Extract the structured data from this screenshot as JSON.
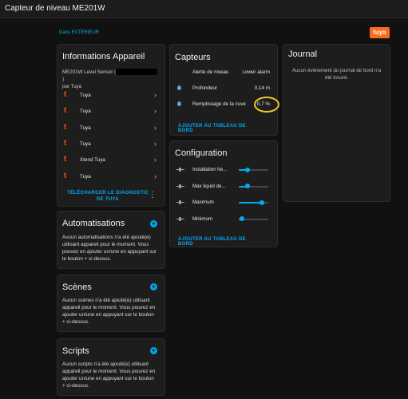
{
  "window": {
    "title": "Capteur de niveau ME201W"
  },
  "area": {
    "link": "Dans EXTERIEUR"
  },
  "brand": {
    "logo_text": "tuya",
    "color": "#ff6a1a"
  },
  "device_info": {
    "title": "Informations Appareil",
    "model_prefix": "ME201W Level Sensor (",
    "model_suffix": ")",
    "manufacturer": "par Tuya",
    "entries": [
      {
        "label": "Tuya",
        "icon": "tuya-icon"
      },
      {
        "label": "Tuya",
        "icon": "tuya-icon"
      },
      {
        "label": "Tuya",
        "icon": "tuya-icon"
      },
      {
        "label": "Tuya",
        "icon": "tuya-icon"
      },
      {
        "label": "Xtend Tuya",
        "icon": "tuya-icon"
      },
      {
        "label": "Tuya",
        "icon": "tuya-icon"
      }
    ],
    "diagnostic_line1": "TÉLÉCHARGER LE DIAGNOSTIC",
    "diagnostic_line2": "DE TUYA"
  },
  "automations": {
    "title": "Automatisations",
    "text": "Aucun automatisations n'a été ajouté(e) utilisant appareil pour le moment. Vous pouvez en ajouter un/une en appuyant sur le bouton + ci-dessus."
  },
  "scenes": {
    "title": "Scènes",
    "text": "Aucun scènes n'a été ajouté(e) utilisant appareil pour le moment. Vous pouvez en ajouter un/une en appuyant sur le bouton + ci-dessus."
  },
  "scripts": {
    "title": "Scripts",
    "text": "Aucun scripts n'a été ajouté(e) utilisant appareil pour le moment. Vous pouvez en ajouter un/une en appuyant sur le bouton + ci-dessus."
  },
  "sensors": {
    "title": "Capteurs",
    "rows": [
      {
        "label": "Alerte de niveau",
        "value": "Lower alarm",
        "icon": "none"
      },
      {
        "label": "Profondeur",
        "value": "0,14 m",
        "icon": "water-drop-icon"
      },
      {
        "label": "Remplissage de la cuve",
        "value": "0,7 %",
        "icon": "water-drop-icon"
      }
    ],
    "add_label": "AJOUTER AU TABLEAU DE BORD",
    "highlight_color": "#f3c529"
  },
  "configuration": {
    "title": "Configuration",
    "rows": [
      {
        "label": "Installation he...",
        "level": 0.29
      },
      {
        "label": "Max liquid de...",
        "level": 0.29
      },
      {
        "label": "Maximum",
        "level": 0.78
      },
      {
        "label": "Minimum",
        "level": 0.12
      }
    ],
    "add_label": "AJOUTER AU TABLEAU DE BORD"
  },
  "journal": {
    "title": "Journal",
    "empty_text": "Aucun événement du journal de bord n'a été trouvé."
  }
}
